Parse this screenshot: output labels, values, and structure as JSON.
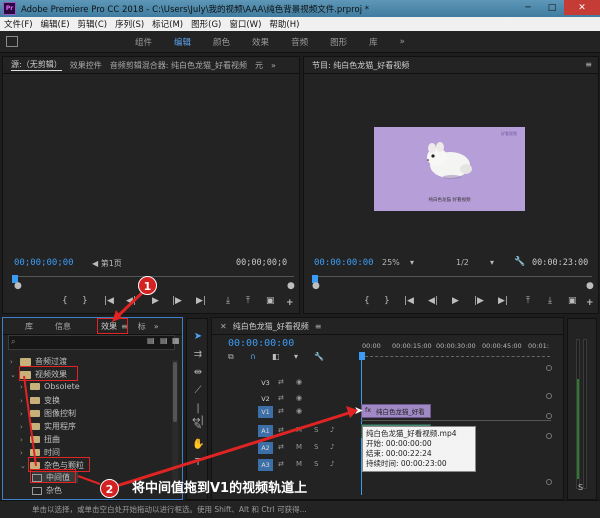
{
  "window": {
    "title": "Adobe Premiere Pro CC 2018 - C:\\Users\\July\\我的视频\\AAA\\纯色背景视频文件.prproj *",
    "app_icon": "Pr",
    "minimize": "─",
    "maximize": "□",
    "close": "✕"
  },
  "menu": [
    "文件(F)",
    "编辑(E)",
    "剪辑(C)",
    "序列(S)",
    "标记(M)",
    "图形(G)",
    "窗口(W)",
    "帮助(H)"
  ],
  "workspaces": {
    "tabs": [
      "组件",
      "编辑",
      "颜色",
      "效果",
      "音频",
      "图形",
      "库"
    ],
    "active": "编辑",
    "more": "»"
  },
  "source_panel": {
    "tabs": [
      "源:（无剪辑）",
      "效果控件",
      "音频剪辑混合器: 纯白色龙猫_好看视频",
      "元"
    ],
    "more": "»",
    "timecode_in": "00;00;00;00",
    "page": "第1页",
    "timecode_out": "00;00;00;0"
  },
  "program_panel": {
    "tab": "节目: 纯白色龙猫_好看视频",
    "timecode": "00:00:00:00",
    "zoom": "25%",
    "resolution": "1/2",
    "duration": "00:00:23:00",
    "preview_caption": "纯白色龙猫 好看视频",
    "preview_watermark": "好看视频"
  },
  "effects_panel": {
    "tabs": [
      "库",
      "信息",
      "效果",
      "标"
    ],
    "active": "效果",
    "more": "»",
    "items": [
      {
        "label": "音频过渡",
        "level": 0,
        "type": "folder",
        "expanded": false
      },
      {
        "label": "视频效果",
        "level": 0,
        "type": "folder",
        "expanded": true
      },
      {
        "label": "Obsolete",
        "level": 1,
        "type": "folder",
        "expanded": false
      },
      {
        "label": "变换",
        "level": 1,
        "type": "folder",
        "expanded": false
      },
      {
        "label": "图像控制",
        "level": 1,
        "type": "folder",
        "expanded": false
      },
      {
        "label": "实用程序",
        "level": 1,
        "type": "folder",
        "expanded": false
      },
      {
        "label": "扭曲",
        "level": 1,
        "type": "folder",
        "expanded": false
      },
      {
        "label": "时间",
        "level": 1,
        "type": "folder",
        "expanded": false
      },
      {
        "label": "杂色与颗粒",
        "level": 1,
        "type": "folder",
        "expanded": true
      },
      {
        "label": "中间值",
        "level": 2,
        "type": "effect"
      },
      {
        "label": "杂色",
        "level": 2,
        "type": "effect"
      }
    ]
  },
  "timeline": {
    "tab": "纯白色龙猫_好看视频",
    "timecode": "00:00:00:00",
    "ruler": [
      "00:00",
      "00:00:15:00",
      "00:00:30:00",
      "00:00:45:00",
      "00:01:"
    ],
    "video_tracks": [
      "V3",
      "V2",
      "V1"
    ],
    "audio_tracks": [
      "A1",
      "A2",
      "A3"
    ],
    "mute": "M",
    "solo": "S",
    "clip_video_label": "纯白色龙猫_好看",
    "tooltip": {
      "name": "纯白色龙猫_好看视频.mp4",
      "start": "开始: 00:00:00:00",
      "end": "结束: 00:00:22:24",
      "duration": "持续时间: 00:00:23:00"
    }
  },
  "status_bar": "单击以选择，或单击空白处开始拖动以进行框选。使用 Shift、Alt 和 Ctrl 可获得...",
  "annotations": {
    "badge1": "1",
    "badge2": "2",
    "instruction": "将中间值拖到V1的视频轨道上"
  },
  "colors": {
    "accent_blue": "#3c9cf5",
    "annotation_red": "#e02424",
    "video_clip": "#a189c6",
    "audio_clip": "#4e8a7a"
  }
}
